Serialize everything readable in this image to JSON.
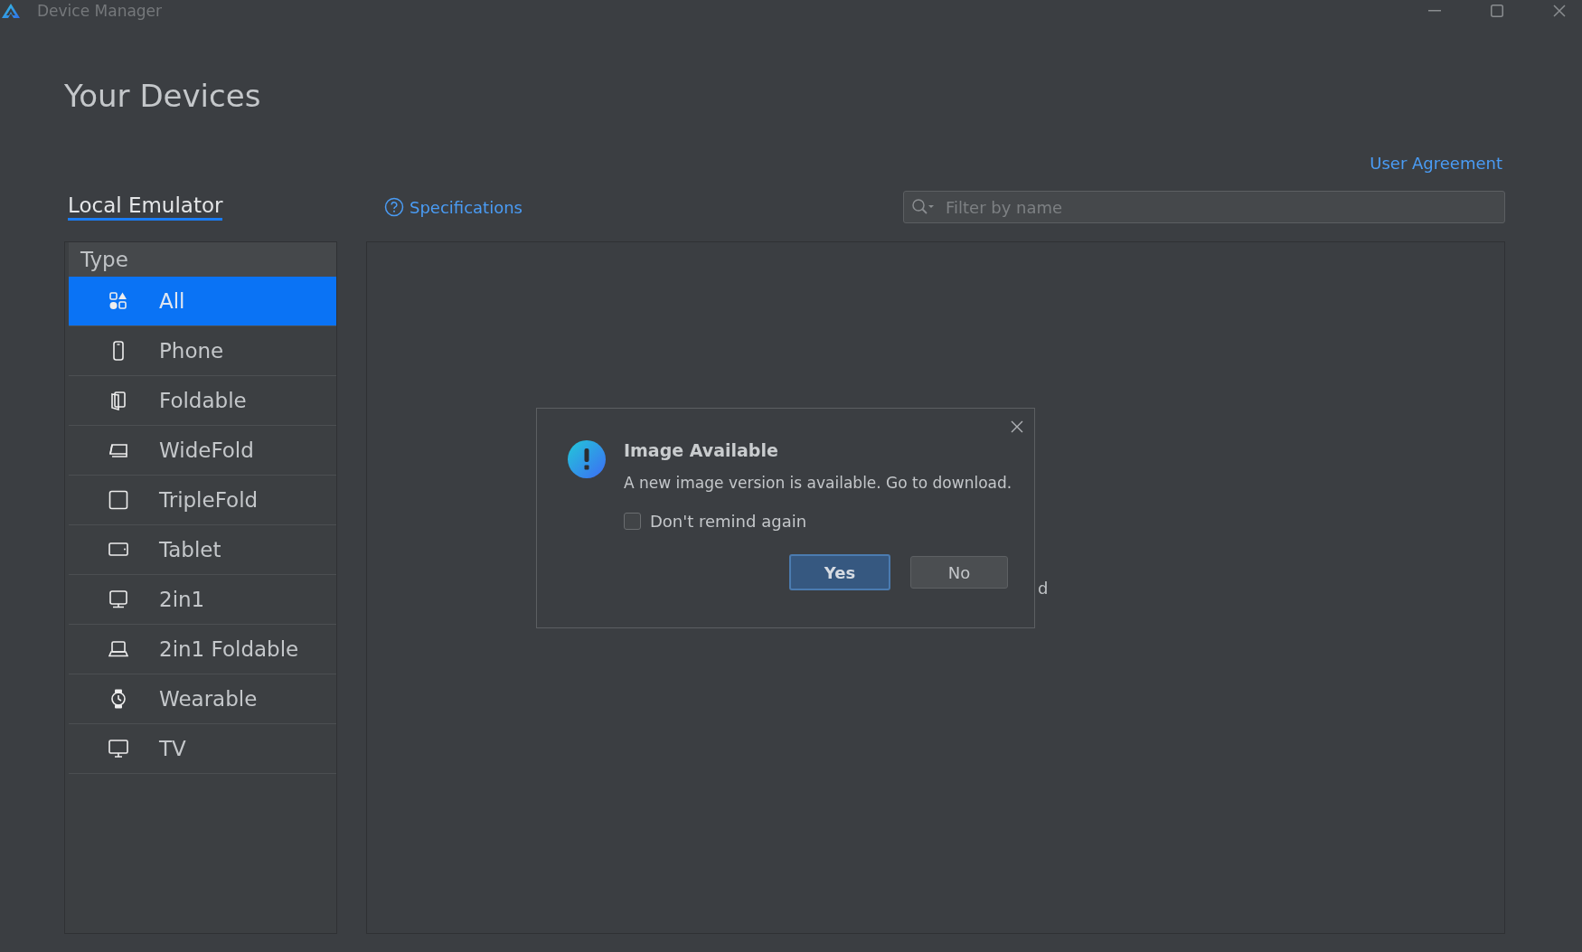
{
  "window": {
    "title": "Device Manager"
  },
  "heading": "Your Devices",
  "user_agreement_link": "User Agreement",
  "tabs": [
    {
      "label": "Local Emulator",
      "selected": true
    }
  ],
  "specifications_link": "Specifications",
  "search": {
    "placeholder": "Filter by name"
  },
  "sidebar": {
    "header": "Type",
    "items": [
      {
        "label": "All",
        "selected": true
      },
      {
        "label": "Phone",
        "selected": false
      },
      {
        "label": "Foldable",
        "selected": false
      },
      {
        "label": "WideFold",
        "selected": false
      },
      {
        "label": "TripleFold",
        "selected": false
      },
      {
        "label": "Tablet",
        "selected": false
      },
      {
        "label": "2in1",
        "selected": false
      },
      {
        "label": "2in1 Foldable",
        "selected": false
      },
      {
        "label": "Wearable",
        "selected": false
      },
      {
        "label": "TV",
        "selected": false
      }
    ]
  },
  "main_panel": {
    "partial_text": "d"
  },
  "dialog": {
    "title": "Image Available",
    "message": "A new image version is available. Go to download.",
    "checkbox": {
      "label": "Don't remind again",
      "checked": false
    },
    "buttons": [
      {
        "label": "Yes",
        "default": true
      },
      {
        "label": "No",
        "default": false
      }
    ]
  }
}
